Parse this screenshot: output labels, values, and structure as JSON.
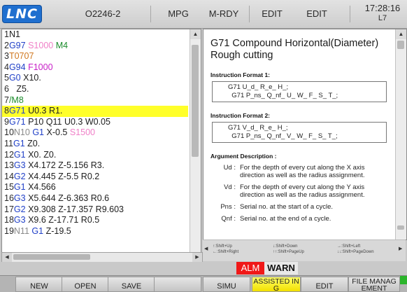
{
  "header": {
    "logo": "LNC",
    "program": "O2246-2",
    "mode": "MPG",
    "status": "M-RDY",
    "state1": "EDIT",
    "state2": "EDIT",
    "time": "17:28:16",
    "subtime": "L7"
  },
  "code": {
    "lines": [
      [
        [
          "ln",
          "1"
        ],
        [
          "txt",
          "N1"
        ]
      ],
      [
        [
          "ln",
          "2"
        ],
        [
          "g",
          "G97"
        ],
        [
          "txt",
          " "
        ],
        [
          "s",
          "S1000"
        ],
        [
          "txt",
          " "
        ],
        [
          "m",
          "M4"
        ]
      ],
      [
        [
          "ln",
          "3"
        ],
        [
          "t",
          "T0707"
        ]
      ],
      [
        [
          "ln",
          "4"
        ],
        [
          "g",
          "G94"
        ],
        [
          "txt",
          " "
        ],
        [
          "f",
          "F1000"
        ]
      ],
      [
        [
          "ln",
          "5"
        ],
        [
          "g",
          "G0"
        ],
        [
          "txt",
          " X10."
        ]
      ],
      [
        [
          "ln",
          "6"
        ],
        [
          "txt",
          "   Z5."
        ]
      ],
      [
        [
          "ln",
          "7"
        ],
        [
          "m",
          "/M8"
        ]
      ],
      [
        [
          "ln",
          "8"
        ],
        [
          "g",
          "G71"
        ],
        [
          "txt",
          " U0.3 R1."
        ]
      ],
      [
        [
          "ln",
          "9"
        ],
        [
          "g",
          "G71"
        ],
        [
          "txt",
          " P10 Q11 U0.3 W0.05"
        ]
      ],
      [
        [
          "ln",
          "10"
        ],
        [
          "n",
          "N10"
        ],
        [
          "txt",
          " "
        ],
        [
          "g",
          "G1"
        ],
        [
          "txt",
          " X-0.5 "
        ],
        [
          "s",
          "S1500"
        ]
      ],
      [
        [
          "ln",
          "11"
        ],
        [
          "g",
          "G1"
        ],
        [
          "txt",
          " Z0."
        ]
      ],
      [
        [
          "ln",
          "12"
        ],
        [
          "g",
          "G1"
        ],
        [
          "txt",
          " X0. Z0."
        ]
      ],
      [
        [
          "ln",
          "13"
        ],
        [
          "g",
          "G3"
        ],
        [
          "txt",
          " X4.172 Z-5.156 R3."
        ]
      ],
      [
        [
          "ln",
          "14"
        ],
        [
          "g",
          "G2"
        ],
        [
          "txt",
          " X4.445 Z-5.5 R0.2"
        ]
      ],
      [
        [
          "ln",
          "15"
        ],
        [
          "g",
          "G1"
        ],
        [
          "txt",
          " X4.566"
        ]
      ],
      [
        [
          "ln",
          "16"
        ],
        [
          "g",
          "G3"
        ],
        [
          "txt",
          " X5.644 Z-6.363 R0.6"
        ]
      ],
      [
        [
          "ln",
          "17"
        ],
        [
          "g",
          "G2"
        ],
        [
          "txt",
          " X9.308 Z-17.357 R9.603"
        ]
      ],
      [
        [
          "ln",
          "18"
        ],
        [
          "g",
          "G3"
        ],
        [
          "txt",
          " X9.6 Z-17.71 R0.5"
        ]
      ],
      [
        [
          "ln",
          "19"
        ],
        [
          "n",
          "N11"
        ],
        [
          "txt",
          " "
        ],
        [
          "g",
          "G1"
        ],
        [
          "txt",
          " Z-19.5"
        ]
      ]
    ],
    "highlight_index": 7
  },
  "help": {
    "title": "G71 Compound Horizontal(Diameter) Rough cutting",
    "fmt1_label": "Instruction Format 1:",
    "fmt1_line1": "G71 U_d_ R_e_ H_;",
    "fmt1_line2": "  G71 P_ns_ Q_nf_ U_ W_ F_ S_ T_;",
    "fmt2_label": "Instruction Format 2:",
    "fmt2_line1": "G71 V_d_ R_e_ H_;",
    "fmt2_line2": "  G71 P_ns_ Q_nf_ V_ W_ F_ S_ T_;",
    "arg_label": "Argument Description :",
    "args": [
      {
        "key": "Ud :",
        "desc": "For the depth of every cut along the X axis direction as well as the radius assignment."
      },
      {
        "key": "Vd :",
        "desc": "For the depth of every cut along the Y axis direction as well as the radius assignment."
      },
      {
        "key": "Pns :",
        "desc": "Serial no. at the start of a cycle."
      },
      {
        "key": "Qnf :",
        "desc": "Serial no. at the end of a cycle."
      }
    ]
  },
  "hints": {
    "h1": "↑:Shift+Up",
    "h2": "←:Shift+Right",
    "h3": "↓:Shift+Down",
    "h4": "↑↑:Shift+PageUp",
    "h5": "→:Shift+Left",
    "h6": "↓↓:Shift+PageDown"
  },
  "alarm": {
    "alm": "ALM",
    "warn": "WARN"
  },
  "softkeys": [
    "NEW",
    "OPEN",
    "SAVE",
    "",
    "SIMU",
    "ASSISTED IN\nG",
    "EDIT",
    "FILE MANAG\nEMENT"
  ],
  "colors": {
    "highlight": "#ffff2a",
    "gcode": "#2040c8",
    "spindle": "#f080c8",
    "mcode": "#1c8c2c",
    "tool": "#d07820",
    "feed": "#c820c8",
    "alarm": "#f01818",
    "active_key": "#f2e000"
  }
}
